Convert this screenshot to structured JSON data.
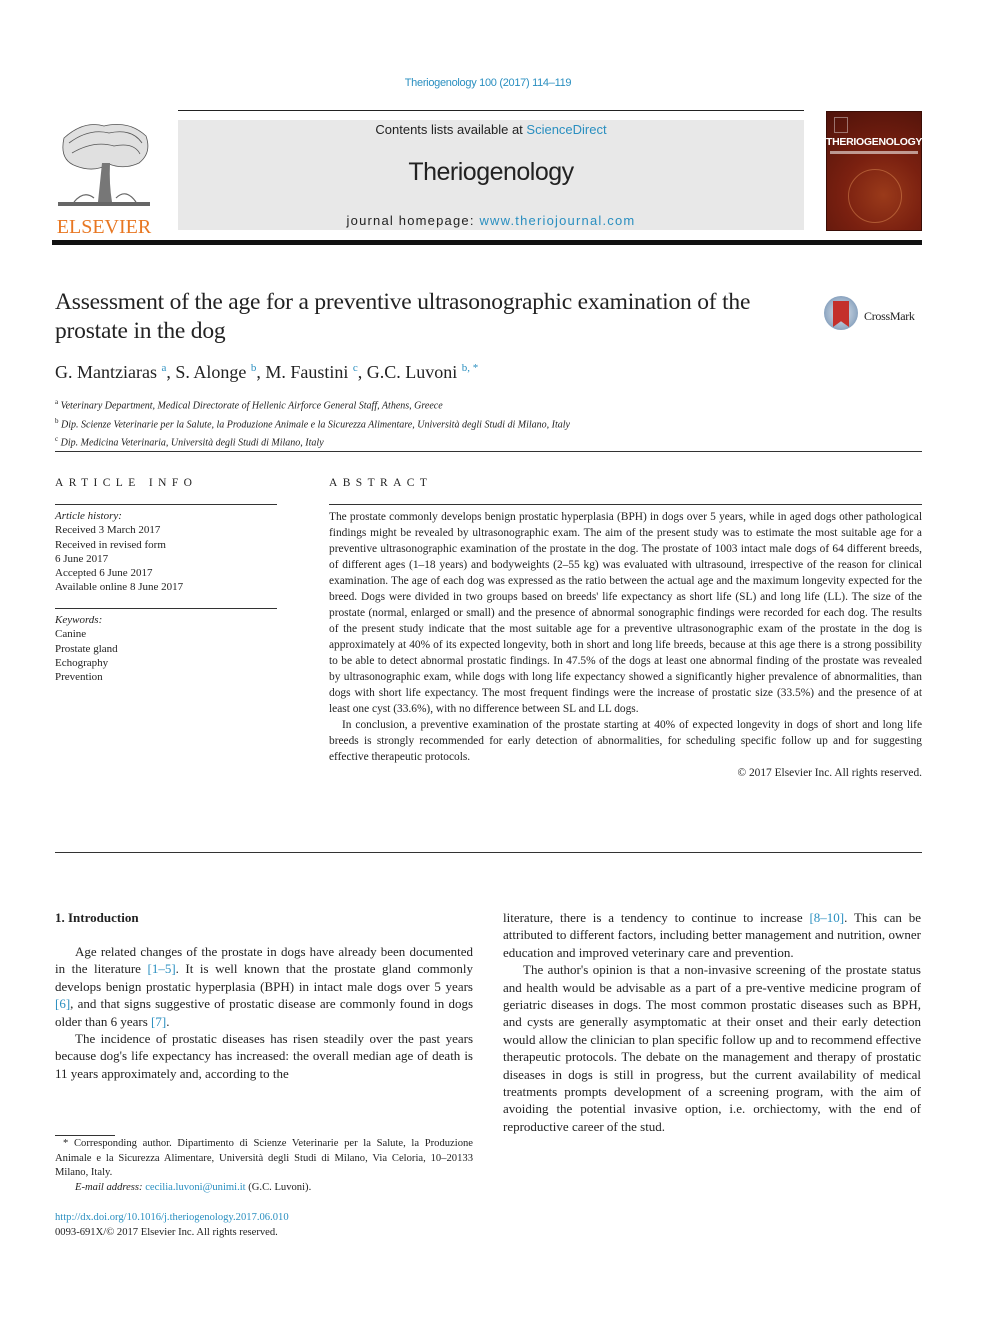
{
  "citation": "Theriogenology 100 (2017) 114–119",
  "banner": {
    "contents_prefix": "Contents lists available at ",
    "contents_link": "ScienceDirect",
    "journal_title": "Theriogenology",
    "homepage_prefix": "journal homepage: ",
    "homepage_link": "www.theriojournal.com"
  },
  "publisher_logo": {
    "wordmark": "ELSEVIER",
    "color": "#e87722"
  },
  "cover": {
    "title": "THERIOGENOLOGY"
  },
  "crossmark": {
    "label": "CrossMark"
  },
  "article": {
    "title": "Assessment of the age for a preventive ultrasonographic examination of the prostate in the dog",
    "authors": [
      {
        "name": "G. Mantziaras",
        "sup": "a",
        "sep": ", "
      },
      {
        "name": "S. Alonge",
        "sup": "b",
        "sep": ", "
      },
      {
        "name": "M. Faustini",
        "sup": "c",
        "sep": ", "
      },
      {
        "name": "G.C. Luvoni",
        "sup": "b, *",
        "sep": ""
      }
    ],
    "affiliations": [
      {
        "sup": "a",
        "text": "Veterinary Department, Medical Directorate of Hellenic Airforce General Staff, Athens, Greece"
      },
      {
        "sup": "b",
        "text": "Dip. Scienze Veterinarie per la Salute, la Produzione Animale e la Sicurezza Alimentare, Università degli Studi di Milano, Italy"
      },
      {
        "sup": "c",
        "text": "Dip. Medicina Veterinaria, Università degli Studi di Milano, Italy"
      }
    ]
  },
  "article_info": {
    "heading": "ARTICLE INFO",
    "history_heading": "Article history:",
    "history": [
      "Received 3 March 2017",
      "Received in revised form",
      "6 June 2017",
      "Accepted 6 June 2017",
      "Available online 8 June 2017"
    ],
    "keywords_heading": "Keywords:",
    "keywords": [
      "Canine",
      "Prostate gland",
      "Echography",
      "Prevention"
    ]
  },
  "abstract": {
    "heading": "ABSTRACT",
    "paragraphs": [
      "The prostate commonly develops benign prostatic hyperplasia (BPH) in dogs over 5 years, while in aged dogs other pathological findings might be revealed by ultrasonographic exam. The aim of the present study was to estimate the most suitable age for a preventive ultrasonographic examination of the prostate in the dog. The prostate of 1003 intact male dogs of 64 different breeds, of different ages (1–18 years) and bodyweights (2–55 kg) was evaluated with ultrasound, irrespective of the reason for clinical examination. The age of each dog was expressed as the ratio between the actual age and the maximum longevity expected for the breed. Dogs were divided in two groups based on breeds' life expectancy as short life (SL) and long life (LL). The size of the prostate (normal, enlarged or small) and the presence of abnormal sonographic findings were recorded for each dog. The results of the present study indicate that the most suitable age for a preventive ultrasonographic exam of the prostate in the dog is approximately at 40% of its expected longevity, both in short and long life breeds, because at this age there is a strong possibility to be able to detect abnormal prostatic findings. In 47.5% of the dogs at least one abnormal finding of the prostate was revealed by ultrasonographic exam, while dogs with long life expectancy showed a significantly higher prevalence of abnormalities, than dogs with short life expectancy. The most frequent findings were the increase of prostatic size (33.5%) and the presence of at least one cyst (33.6%), with no difference between SL and LL dogs.",
      "In conclusion, a preventive examination of the prostate starting at 40% of expected longevity in dogs of short and long life breeds is strongly recommended for early detection of abnormalities, for scheduling specific follow up and for suggesting effective therapeutic protocols."
    ],
    "copyright": "© 2017 Elsevier Inc. All rights reserved."
  },
  "introduction": {
    "heading": "1.  Introduction",
    "p1": {
      "a": "Age related changes of the prostate in dogs have already been documented in the literature ",
      "ref1": "[1–5]",
      "b": ". It is well known that the prostate gland commonly develops benign prostatic hyperplasia (BPH) in intact male dogs over 5 years ",
      "ref2": "[6]",
      "c": ", and that signs suggestive of prostatic disease are commonly found in dogs older than 6 years ",
      "ref3": "[7]",
      "d": "."
    },
    "p2": {
      "a": "The incidence of prostatic diseases has risen steadily over the past years because dog's life expectancy has increased: the overall median age of death is 11 years approximately and, according to the literature, there is a tendency to continue to increase ",
      "ref1": "[8–10]",
      "b": ". This can be attributed to different factors, including better management and nutrition, owner education and improved veterinary care and prevention."
    },
    "p3": "The author's opinion is that a non-invasive screening of the prostate status and health would be advisable as a part of a pre-ventive medicine program of geriatric diseases in dogs. The most common prostatic diseases such as BPH, and cysts are generally asymptomatic at their onset and their early detection would allow the clinician to plan specific follow up and to recommend effective therapeutic protocols. The debate on the management and therapy of prostatic diseases in dogs is still in progress, but the current availability of medical treatments prompts development of a screening program, with the aim of avoiding the potential invasive option, i.e. orchiectomy, with the end of reproductive career of the stud."
  },
  "footnotes": {
    "corresponding": "* Corresponding author. Dipartimento di Scienze Veterinarie per la Salute, la Produzione Animale e la Sicurezza Alimentare, Università degli Studi di Milano, Via Celoria, 10–20133 Milano, Italy.",
    "email_label": "E-mail address: ",
    "email": "cecilia.luvoni@unimi.it",
    "email_suffix": " (G.C. Luvoni).",
    "doi": "http://dx.doi.org/10.1016/j.theriogenology.2017.06.010",
    "issn_line": "0093-691X/© 2017 Elsevier Inc. All rights reserved."
  }
}
